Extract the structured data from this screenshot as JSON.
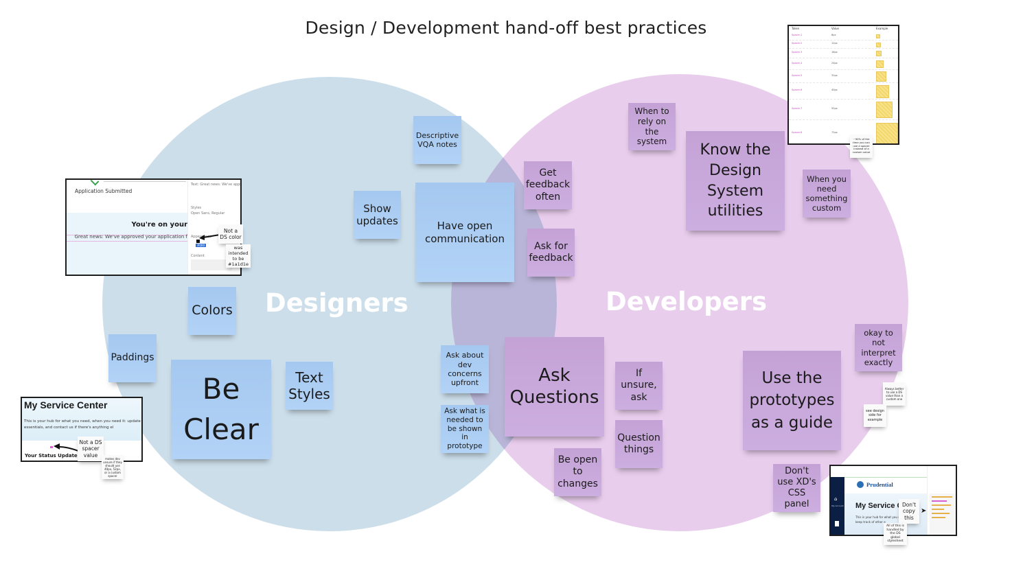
{
  "title": "Design / Development hand-off best practices",
  "colors": {
    "designers_circle": "#ccdeea",
    "developers_circle": "#e8cdec",
    "overlap": "#b9b5d8",
    "blue_note": "#a9cbf2",
    "purple_note": "#c7a6da"
  },
  "sets": {
    "designers": "Designers",
    "developers": "Developers"
  },
  "designer_notes": {
    "colors": "Colors",
    "paddings": "Paddings",
    "be_clear": "Be Clear",
    "text_styles": "Text Styles",
    "show_updates": "Show updates"
  },
  "shared_notes": {
    "descriptive_vqa": "Descriptive VQA notes",
    "open_communication": "Have open communication",
    "dev_concerns": "Ask about dev concerns upfront",
    "prototype_needs": "Ask what is needed to be shown in prototype",
    "get_feedback": "Get feedback often",
    "ask_feedback": "Ask for feedback",
    "ask_questions": "Ask Questions"
  },
  "developer_notes": {
    "rely_on_system": "When to rely on the system",
    "know_ds": "Know the Design System utilities",
    "need_custom": "When you need something custom",
    "if_unsure": "If unsure, ask",
    "question_things": "Question things",
    "open_to_changes": "Be open to changes",
    "use_prototypes": "Use the prototypes as a guide",
    "not_interpret": "okay to not interpret exactly",
    "dont_use_css": "Don't use XD's CSS panel"
  },
  "screenshot_app_submitted": {
    "heading": "Application Submitted",
    "banner_title": "You're on your",
    "banner_text": "Great news: We've approved your application f",
    "panel_text_label": "Text: Great news: We've approved you...",
    "panel_styles": "Styles",
    "panel_font": "Open Sans, Regular",
    "panel_appearance": "Appearance",
    "panel_content": "Content",
    "panel_swatch_tag": "#000",
    "callout_not_ds": "Not a DS color",
    "callout_intended": "was intended to be #1a1d1e"
  },
  "screenshot_service_center": {
    "heading": "My Service Center",
    "body": "This is your hub for what you need, when you need it: update your keep track of other essentials, and contact us if there's anything el",
    "status": "Your Status Update",
    "callout_spacer": "Not a DS spacer value",
    "callout_unsure": "makes dev unsure if they should use 40px, 52px, or a custom spacer"
  },
  "screenshot_spacer_table": {
    "headers": [
      "Token",
      "Value",
      "Example"
    ],
    "rows": [
      {
        "token": "Spacer-1",
        "value": "8px"
      },
      {
        "token": "Spacer-2",
        "value": "12px"
      },
      {
        "token": "Spacer-3",
        "value": "16px"
      },
      {
        "token": "Spacer-4",
        "value": "24px"
      },
      {
        "token": "Spacer-5",
        "value": "32px"
      },
      {
        "token": "Spacer-6",
        "value": "40px"
      },
      {
        "token": "Spacer-7",
        "value": "52px"
      },
      {
        "token": "Spacer-8",
        "value": "72px"
      }
    ],
    "callout": "~90% of the time you can use a spacer instead of a custom value"
  },
  "side_callouts": {
    "ds_better": "Always better to use a DS value than a custom one",
    "see_design": "see design side for example"
  },
  "screenshot_prudential": {
    "brand": "Prudential",
    "heading": "My Service C",
    "body": "This is your hub for what you n keep track of other e",
    "nav_account": "My Account",
    "callout_dont_copy": "Don't copy this",
    "callout_handled": "All of this is handled by the DS global stylesheet"
  }
}
